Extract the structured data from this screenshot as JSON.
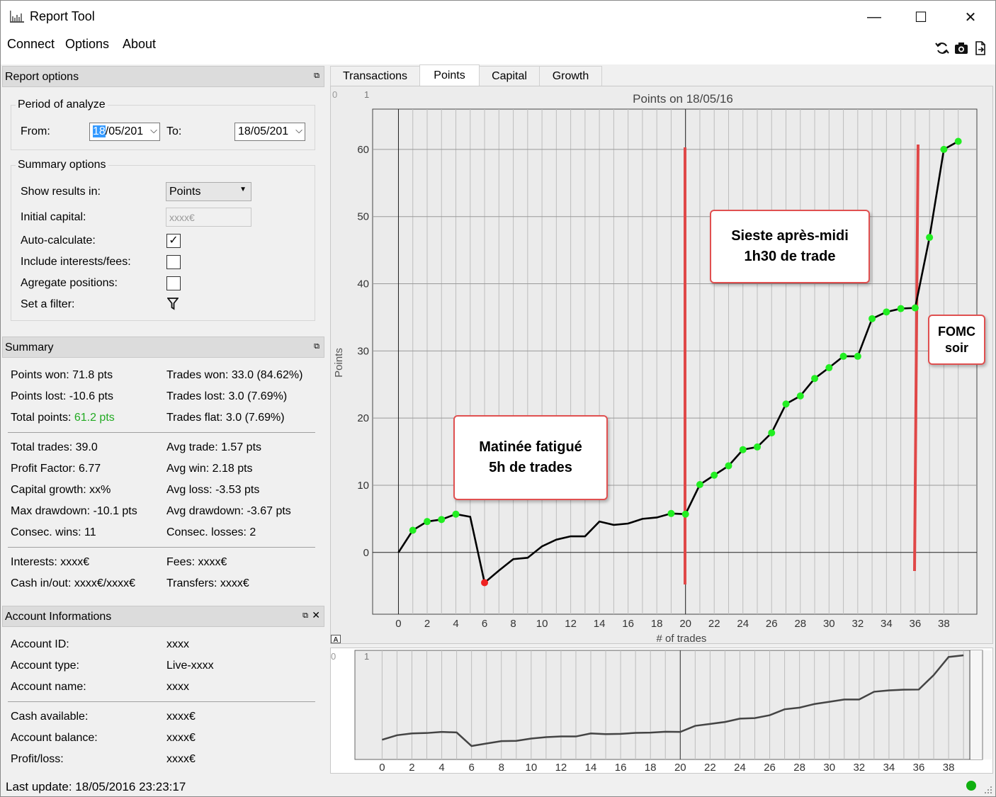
{
  "window": {
    "title": "Report Tool",
    "minimize": "—",
    "maximize": "☐",
    "close": "✕"
  },
  "menu": [
    "Connect",
    "Options",
    "About"
  ],
  "toolbar_icons": [
    "refresh-icon",
    "camera-icon",
    "export-icon"
  ],
  "report_options": {
    "header": "Report options",
    "period_title": "Period of analyze",
    "from_label": "From:",
    "from_value_sel": "18",
    "from_value_rest": "/05/201",
    "to_label": "To:",
    "to_value": "18/05/201",
    "summary_title": "Summary options",
    "show_results_label": "Show results in:",
    "show_results_value": "Points",
    "initial_capital_label": "Initial capital:",
    "initial_capital_placeholder": "xxxx€",
    "auto_calculate_label": "Auto-calculate:",
    "auto_calculate_checked": "✓",
    "include_interests_label": "Include interests/fees:",
    "aggregate_label": "Agregate positions:",
    "filter_label": "Set a filter:"
  },
  "summary": {
    "header": "Summary",
    "points_won": "Points won: 71.8 pts",
    "points_lost": "Points lost: -10.6 pts",
    "total_points_label": "Total points: ",
    "total_points_value": "61.2 pts",
    "total_points_color": "#22aa22",
    "trades_won": "Trades won: 33.0 (84.62%)",
    "trades_lost": "Trades lost: 3.0 (7.69%)",
    "trades_flat": "Trades flat: 3.0 (7.69%)",
    "total_trades": "Total trades: 39.0",
    "profit_factor": "Profit Factor: 6.77",
    "capital_growth": "Capital growth: xx%",
    "max_drawdown": "Max drawdown: -10.1 pts",
    "consec_wins": "Consec. wins: 11",
    "avg_trade": "Avg trade: 1.57 pts",
    "avg_win": "Avg win: 2.18 pts",
    "avg_loss": "Avg loss: -3.53 pts",
    "avg_drawdown": "Avg drawdown: -3.67 pts",
    "consec_losses": "Consec. losses: 2",
    "interests": "Interests: xxxx€",
    "fees": "Fees: xxxx€",
    "cash_inout": "Cash in/out: xxxx€/xxxx€",
    "transfers": "Transfers: xxxx€"
  },
  "account": {
    "header": "Account Informations",
    "id_label": "Account ID:",
    "id_value": "xxxx",
    "type_label": "Account type:",
    "type_value": "Live-xxxx",
    "name_label": "Account name:",
    "name_value": "xxxx",
    "cash_label": "Cash available:",
    "cash_value": "xxxx€",
    "balance_label": "Account balance:",
    "balance_value": "xxxx€",
    "pl_label": "Profit/loss:",
    "pl_value": "xxxx€"
  },
  "tabs": [
    "Transactions",
    "Points",
    "Capital",
    "Growth"
  ],
  "status": {
    "last_update": "Last update: 18/05/2016 23:23:17",
    "dot_color": "#10b010"
  },
  "annotations": {
    "morning": [
      "Matinée fatigué",
      "5h de trades"
    ],
    "nap": [
      "Sieste après-midi",
      "1h30 de trade"
    ],
    "fomc": [
      "FOMC",
      "soir"
    ]
  },
  "chart_data": {
    "type": "line",
    "title": "Points on 18/05/16",
    "xlabel": "# of trades",
    "ylabel": "Points",
    "corner_labels": [
      "0",
      "1"
    ],
    "xlim": [
      -1.8,
      40.3
    ],
    "ylim": [
      -9.2,
      66
    ],
    "xticks": [
      0,
      2,
      4,
      6,
      8,
      10,
      12,
      14,
      16,
      18,
      20,
      22,
      24,
      26,
      28,
      30,
      32,
      34,
      36,
      38
    ],
    "yticks": [
      0,
      10,
      20,
      30,
      40,
      50,
      60
    ],
    "grid": true,
    "marker_color": "#22ee22",
    "drawdown_marker_color": "#ee2222",
    "series": [
      {
        "x": [
          0,
          1,
          2,
          3,
          4,
          5,
          6,
          7,
          8,
          9,
          10,
          11,
          12,
          13,
          14,
          15,
          16,
          17,
          18,
          19,
          20,
          21,
          22,
          23,
          24,
          25,
          26,
          27,
          28,
          29,
          30,
          31,
          32,
          33,
          34,
          35,
          36,
          37,
          38,
          39
        ],
        "values": [
          0,
          3.3,
          4.6,
          4.9,
          5.7,
          5.3,
          -4.5,
          -2.7,
          -1.0,
          -0.8,
          0.9,
          1.9,
          2.4,
          2.4,
          4.6,
          4.1,
          4.3,
          5.0,
          5.2,
          5.8,
          5.7,
          10.1,
          11.5,
          12.9,
          15.3,
          15.7,
          17.8,
          22.1,
          23.3,
          25.9,
          27.5,
          29.2,
          29.2,
          34.8,
          35.8,
          36.3,
          36.4,
          46.9,
          60.0,
          61.2
        ],
        "markers": [
          1,
          2,
          3,
          4,
          6,
          19,
          20,
          21,
          22,
          23,
          24,
          25,
          26,
          27,
          28,
          29,
          30,
          31,
          32,
          33,
          34,
          35,
          36,
          37,
          38,
          39
        ],
        "red_markers": [
          6
        ]
      }
    ],
    "vlines": [
      20,
      36
    ]
  }
}
